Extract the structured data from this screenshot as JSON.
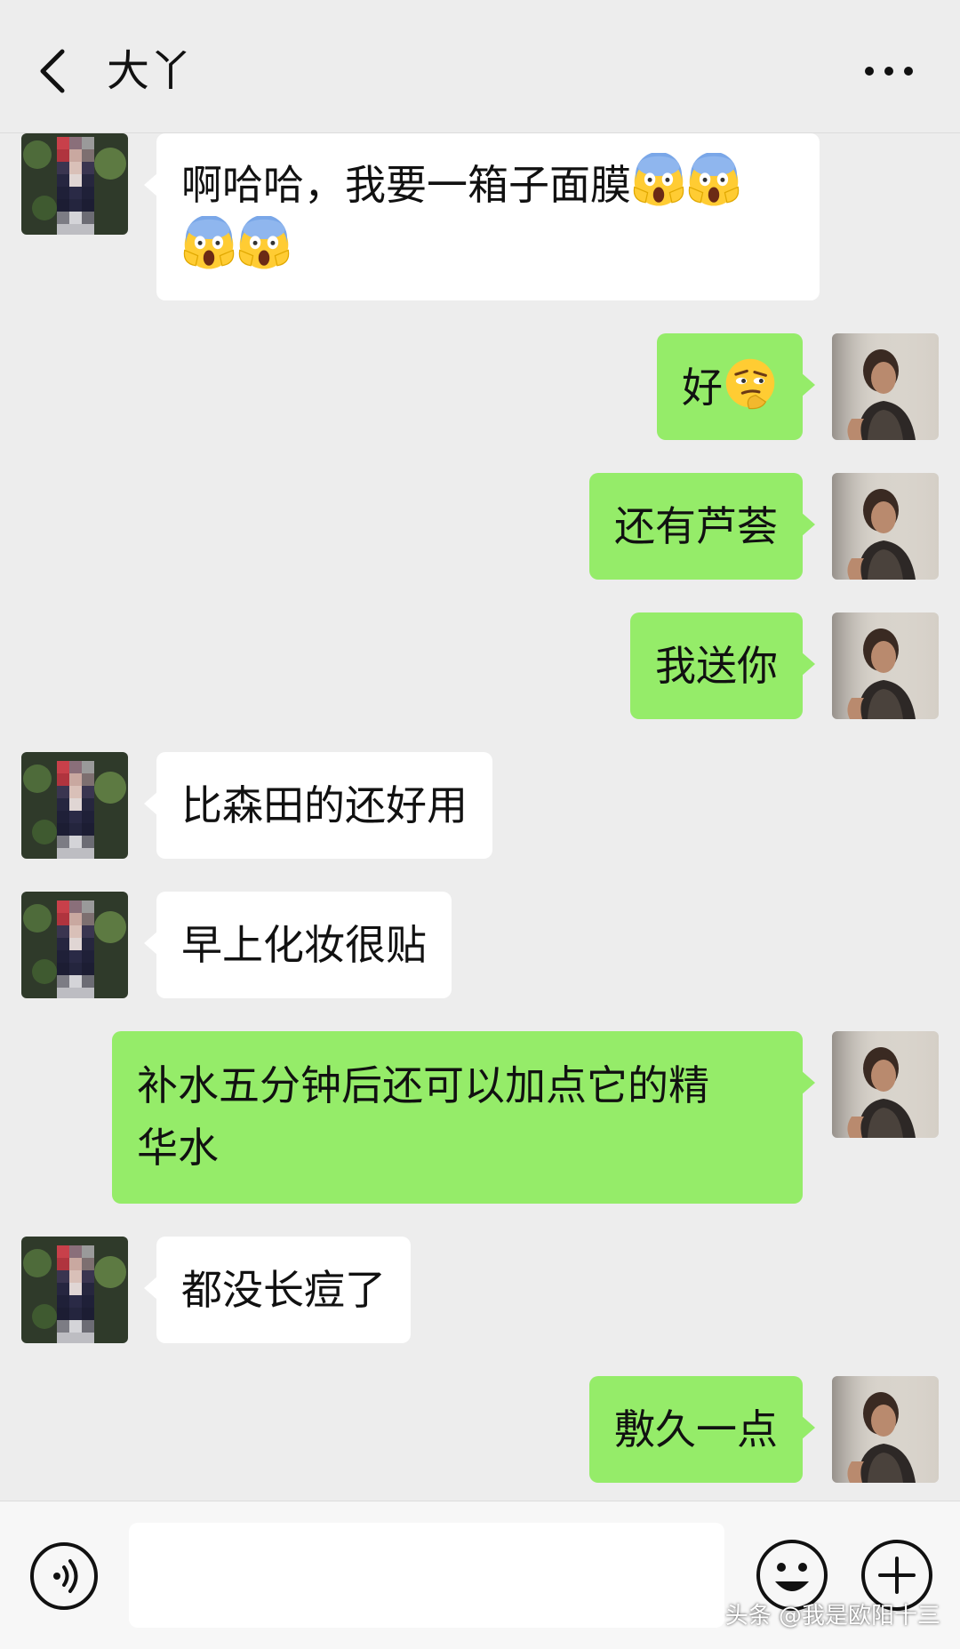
{
  "header": {
    "title": "大丫"
  },
  "messages": [
    {
      "side": "incoming",
      "text": "啊哈哈，我要一箱子面膜",
      "emoji_count": 4
    },
    {
      "side": "outgoing",
      "text": "好",
      "emoji_count": 1
    },
    {
      "side": "outgoing",
      "text": "还有芦荟"
    },
    {
      "side": "outgoing",
      "text": "我送你"
    },
    {
      "side": "incoming",
      "text": "比森田的还好用"
    },
    {
      "side": "incoming",
      "text": "早上化妆很贴"
    },
    {
      "side": "outgoing",
      "line1": "补水五分钟后还可以加点它的精",
      "line2": "华水"
    },
    {
      "side": "incoming",
      "text": "都没长痘了"
    },
    {
      "side": "outgoing",
      "text": "敷久一点"
    }
  ],
  "input": {
    "value": "",
    "placeholder": ""
  },
  "watermark": "头条 @我是欧阳十三",
  "icons": {
    "back": "chevron-left-icon",
    "more": "more-dots-icon",
    "voice": "voice-icon",
    "emoji": "smiley-icon",
    "plus": "plus-icon",
    "scream": "face-screaming-in-fear-emoji",
    "smirk": "face-with-raised-eyebrow-emoji"
  },
  "colors": {
    "background": "#ededed",
    "outgoing_bubble": "#95ec69",
    "incoming_bubble": "#ffffff",
    "bottom_bar": "#f7f7f7"
  }
}
